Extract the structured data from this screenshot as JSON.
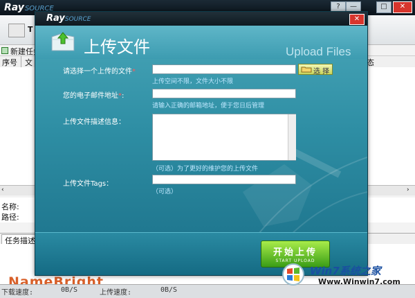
{
  "main": {
    "logo": "Ray",
    "logo_suffix": "SOURCE",
    "toolbar_first_letter": "T",
    "new_task_label": "新建任务",
    "list_headers": [
      "序号",
      "文",
      "态"
    ],
    "detail_name_label": "名称:",
    "detail_path_label": "路径:",
    "tab_label": "任务描述",
    "window_buttons": [
      "?",
      "—",
      "□",
      "✕"
    ],
    "status": {
      "download_speed_label": "下载速度:",
      "download_speed_value": "0B/S",
      "upload_speed_label": "上传速度:",
      "upload_speed_value": "0B/S"
    },
    "ad_text": "NameBright"
  },
  "dialog": {
    "logo": "Ray",
    "logo_suffix": "SOURCE",
    "close_label": "✕",
    "title": "上传文件",
    "subtitle": "Upload Files",
    "form": {
      "file_label": "请选择一个上传的文件",
      "file_required": "*",
      "file_value": "",
      "file_hint": "上传空间不限，文件大小不限",
      "browse_label": "选 择",
      "email_label": "您的电子邮件地址",
      "email_required": "*",
      "email_suffix": ":",
      "email_value": "",
      "email_hint": "请输入正确的邮箱地址，便于您日后管理",
      "desc_label": "上传文件描述信息：",
      "desc_value": "",
      "desc_hint": "（可选）为了更好的维护您的上传文件",
      "tags_label": "上传文件Tags：",
      "tags_value": "",
      "tags_hint": "（可选）"
    },
    "start_label": "开始上传",
    "start_sublabel": "START UPLOAD"
  },
  "watermark": {
    "text": "Win7系统之家",
    "url": "Www.Winwin7.com"
  }
}
